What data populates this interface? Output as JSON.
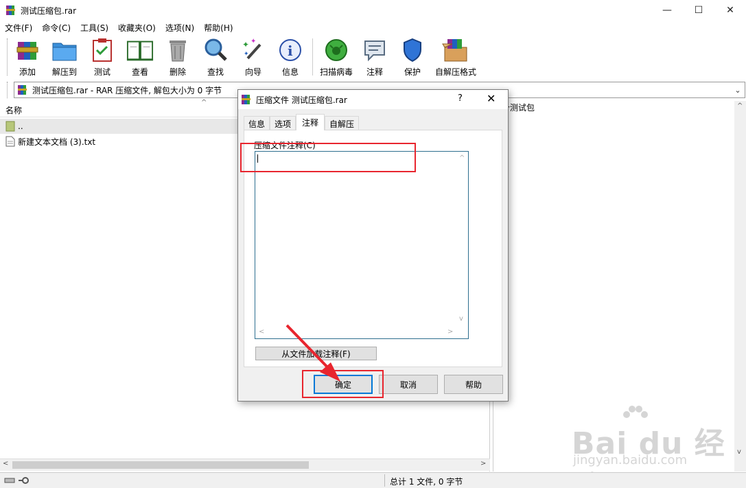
{
  "window": {
    "title": "测试压缩包.rar",
    "controls": [
      "—",
      "☐",
      "✕"
    ]
  },
  "menu": [
    "文件(F)",
    "命令(C)",
    "工具(S)",
    "收藏夹(O)",
    "选项(N)",
    "帮助(H)"
  ],
  "toolbar": [
    {
      "label": "添加",
      "icon": "add-archive-icon"
    },
    {
      "label": "解压到",
      "icon": "extract-folder-icon"
    },
    {
      "label": "测试",
      "icon": "test-clipboard-icon"
    },
    {
      "label": "查看",
      "icon": "view-book-icon"
    },
    {
      "label": "删除",
      "icon": "trash-icon"
    },
    {
      "label": "查找",
      "icon": "magnifier-icon"
    },
    {
      "label": "向导",
      "icon": "wizard-wand-icon"
    },
    {
      "label": "信息",
      "icon": "info-icon"
    },
    {
      "label": "扫描病毒",
      "icon": "virus-scan-icon"
    },
    {
      "label": "注释",
      "icon": "comment-icon"
    },
    {
      "label": "保护",
      "icon": "shield-icon"
    },
    {
      "label": "自解压格式",
      "icon": "sfx-box-icon"
    }
  ],
  "address": {
    "text": "测试压缩包.rar - RAR 压缩文件, 解包大小为 0 字节"
  },
  "filelist": {
    "column_name": "名称",
    "rows": [
      {
        "name": ".."
      },
      {
        "name": "新建文本文档 (3).txt"
      }
    ]
  },
  "comment_pane": {
    "text": "一个测试包"
  },
  "status": {
    "text": "总计 1 文件, 0 字节"
  },
  "watermark": {
    "main": "Bai du 经验",
    "sub": "jingyan.baidu.com"
  },
  "dialog": {
    "title": "压缩文件 测试压缩包.rar",
    "help": "?",
    "close": "✕",
    "tabs": [
      "信息",
      "选项",
      "注释",
      "自解压"
    ],
    "active_tab": "注释",
    "comment_label": "压缩文件注释(C)",
    "comment_value": "",
    "load_button": "从文件加载注释(F)",
    "ok": "确定",
    "cancel": "取消",
    "help_button": "帮助"
  },
  "colors": {
    "annotation_red": "#e8252e",
    "focus_blue": "#0078d7"
  }
}
